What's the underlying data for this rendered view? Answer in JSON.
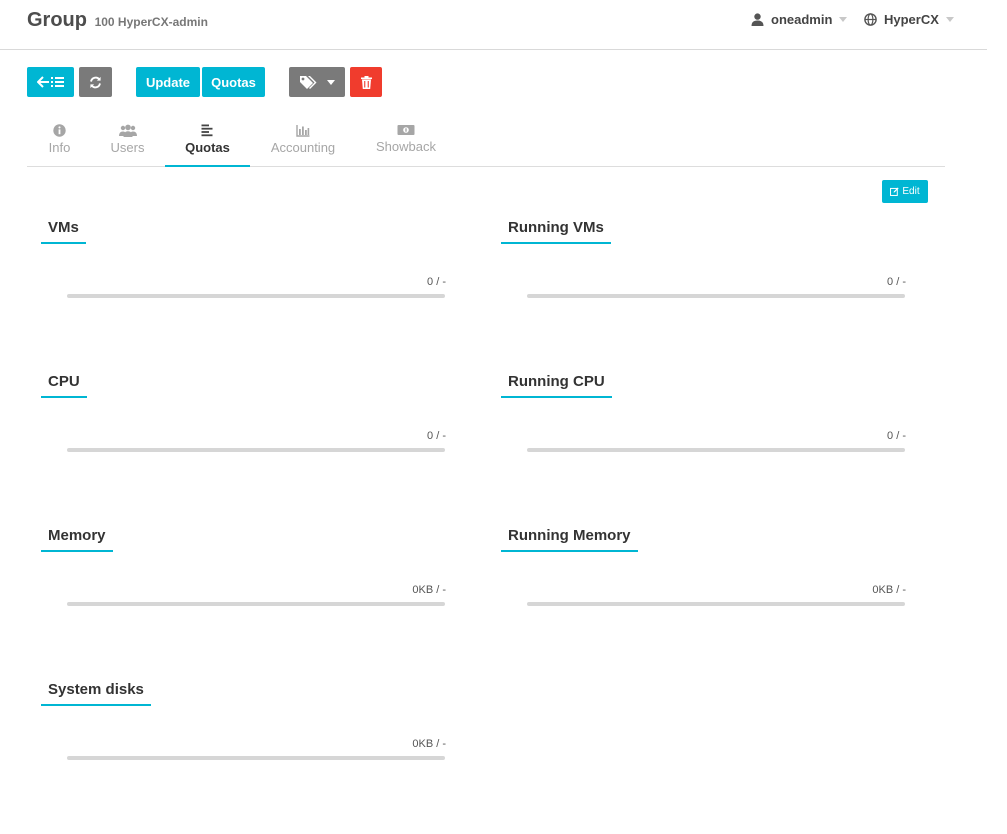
{
  "header": {
    "title": "Group",
    "subtitle": "100 HyperCX-admin",
    "user": "oneadmin",
    "zone": "HyperCX"
  },
  "toolbar": {
    "update_label": "Update",
    "quotas_label": "Quotas"
  },
  "tabs": [
    {
      "label": "Info",
      "icon": "info-icon"
    },
    {
      "label": "Users",
      "icon": "users-icon"
    },
    {
      "label": "Quotas",
      "icon": "align-left-icon"
    },
    {
      "label": "Accounting",
      "icon": "bar-chart-icon"
    },
    {
      "label": "Showback",
      "icon": "money-icon"
    }
  ],
  "edit_label": "Edit",
  "quotas": [
    {
      "title": "VMs",
      "value": "0 / -",
      "fill": 0
    },
    {
      "title": "Running VMs",
      "value": "0 / -",
      "fill": 0
    },
    {
      "title": "CPU",
      "value": "0 / -",
      "fill": 0
    },
    {
      "title": "Running CPU",
      "value": "0 / -",
      "fill": 0
    },
    {
      "title": "Memory",
      "value": "0KB / -",
      "fill": 0
    },
    {
      "title": "Running Memory",
      "value": "0KB / -",
      "fill": 0
    },
    {
      "title": "System disks",
      "value": "0KB / -",
      "fill": 0
    }
  ],
  "colors": {
    "accent": "#00b6d3",
    "danger": "#f03c2d",
    "neutral": "#7a7a7a"
  }
}
